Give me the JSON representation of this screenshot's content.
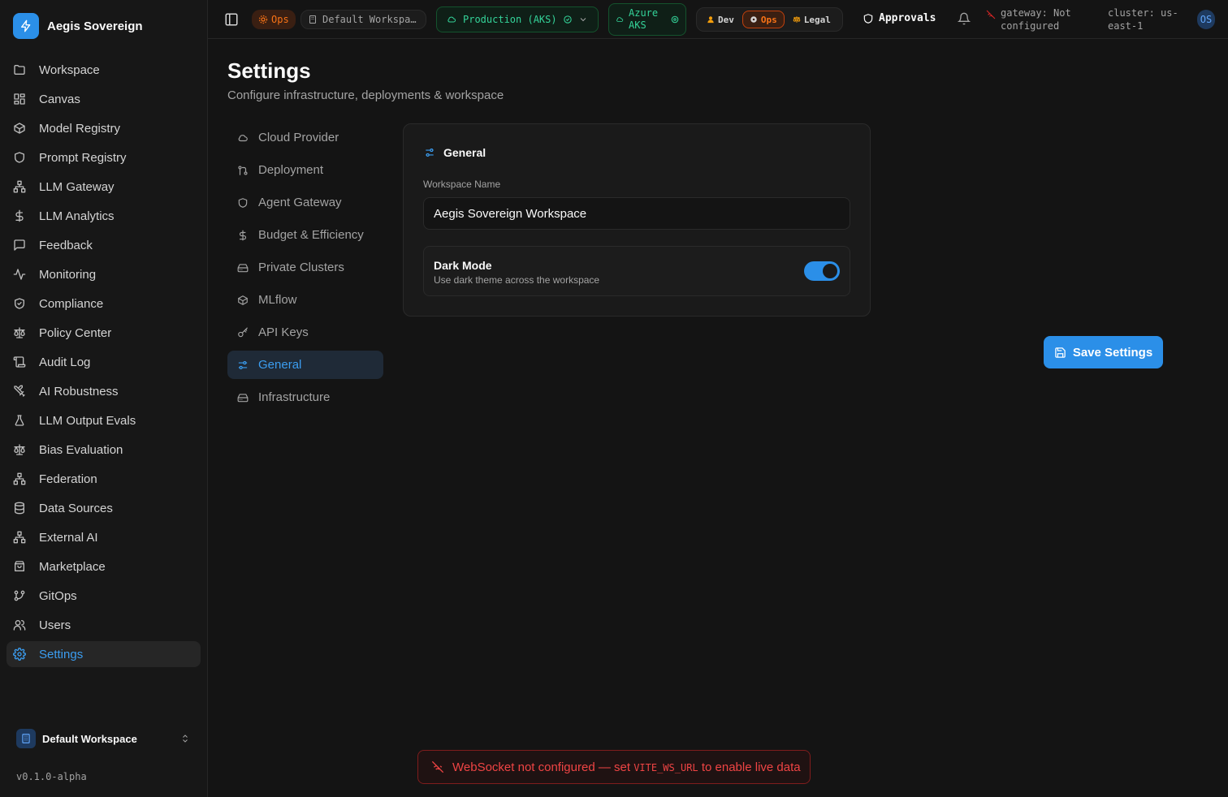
{
  "app": {
    "name": "Aegis Sovereign",
    "version": "v0.1.0-alpha"
  },
  "sidebar": {
    "items": [
      {
        "label": "Workspace",
        "icon": "folder-icon"
      },
      {
        "label": "Canvas",
        "icon": "grid-icon"
      },
      {
        "label": "Model Registry",
        "icon": "box-icon"
      },
      {
        "label": "Prompt Registry",
        "icon": "shield-icon"
      },
      {
        "label": "LLM Gateway",
        "icon": "network-icon"
      },
      {
        "label": "LLM Analytics",
        "icon": "dollar-icon"
      },
      {
        "label": "Feedback",
        "icon": "message-icon"
      },
      {
        "label": "Monitoring",
        "icon": "activity-icon"
      },
      {
        "label": "Compliance",
        "icon": "shield-check-icon"
      },
      {
        "label": "Policy Center",
        "icon": "scale-icon"
      },
      {
        "label": "Audit Log",
        "icon": "scroll-icon"
      },
      {
        "label": "AI Robustness",
        "icon": "swords-icon"
      },
      {
        "label": "LLM Output Evals",
        "icon": "flask-icon"
      },
      {
        "label": "Bias Evaluation",
        "icon": "scale-icon"
      },
      {
        "label": "Federation",
        "icon": "network-icon"
      },
      {
        "label": "Data Sources",
        "icon": "database-icon"
      },
      {
        "label": "External AI",
        "icon": "network-icon"
      },
      {
        "label": "Marketplace",
        "icon": "store-icon"
      },
      {
        "label": "GitOps",
        "icon": "git-branch-icon"
      },
      {
        "label": "Users",
        "icon": "users-icon"
      },
      {
        "label": "Settings",
        "icon": "gear-icon"
      }
    ],
    "workspace_switcher": "Default Workspace"
  },
  "topbar": {
    "role_badge": "Ops",
    "workspace": "Default Workspa…",
    "environment": "Production (AKS)",
    "cloud_line1": "Azure",
    "cloud_line2": "AKS",
    "roles": [
      "Dev",
      "Ops",
      "Legal"
    ],
    "approvals": "Approvals",
    "gateway_line1": "gateway: Not",
    "gateway_line2": "configured",
    "cluster_line1": "cluster: us-",
    "cluster_line2": "east-1",
    "avatar": "OS"
  },
  "main": {
    "title": "Settings",
    "subtitle": "Configure infrastructure, deployments & workspace",
    "subnav": [
      {
        "label": "Cloud Provider",
        "icon": "cloud-icon"
      },
      {
        "label": "Deployment",
        "icon": "git-icon"
      },
      {
        "label": "Agent Gateway",
        "icon": "shield-icon"
      },
      {
        "label": "Budget & Efficiency",
        "icon": "dollar-icon"
      },
      {
        "label": "Private Clusters",
        "icon": "drive-icon"
      },
      {
        "label": "MLflow",
        "icon": "box-icon"
      },
      {
        "label": "API Keys",
        "icon": "key-icon"
      },
      {
        "label": "General",
        "icon": "sliders-icon"
      },
      {
        "label": "Infrastructure",
        "icon": "drive-icon"
      }
    ],
    "card": {
      "title": "General",
      "workspace_name_label": "Workspace Name",
      "workspace_name_value": "Aegis Sovereign Workspace",
      "dark_mode_title": "Dark Mode",
      "dark_mode_desc": "Use dark theme across the workspace",
      "dark_mode_on": true
    },
    "save_button": "Save Settings"
  },
  "toast": {
    "prefix": "WebSocket not configured — set",
    "code": "VITE_WS_URL",
    "suffix": "to enable live data"
  },
  "colors": {
    "accent": "#2b8fe8",
    "ops": "#f97316",
    "success": "#34d399",
    "error": "#ef4444"
  }
}
